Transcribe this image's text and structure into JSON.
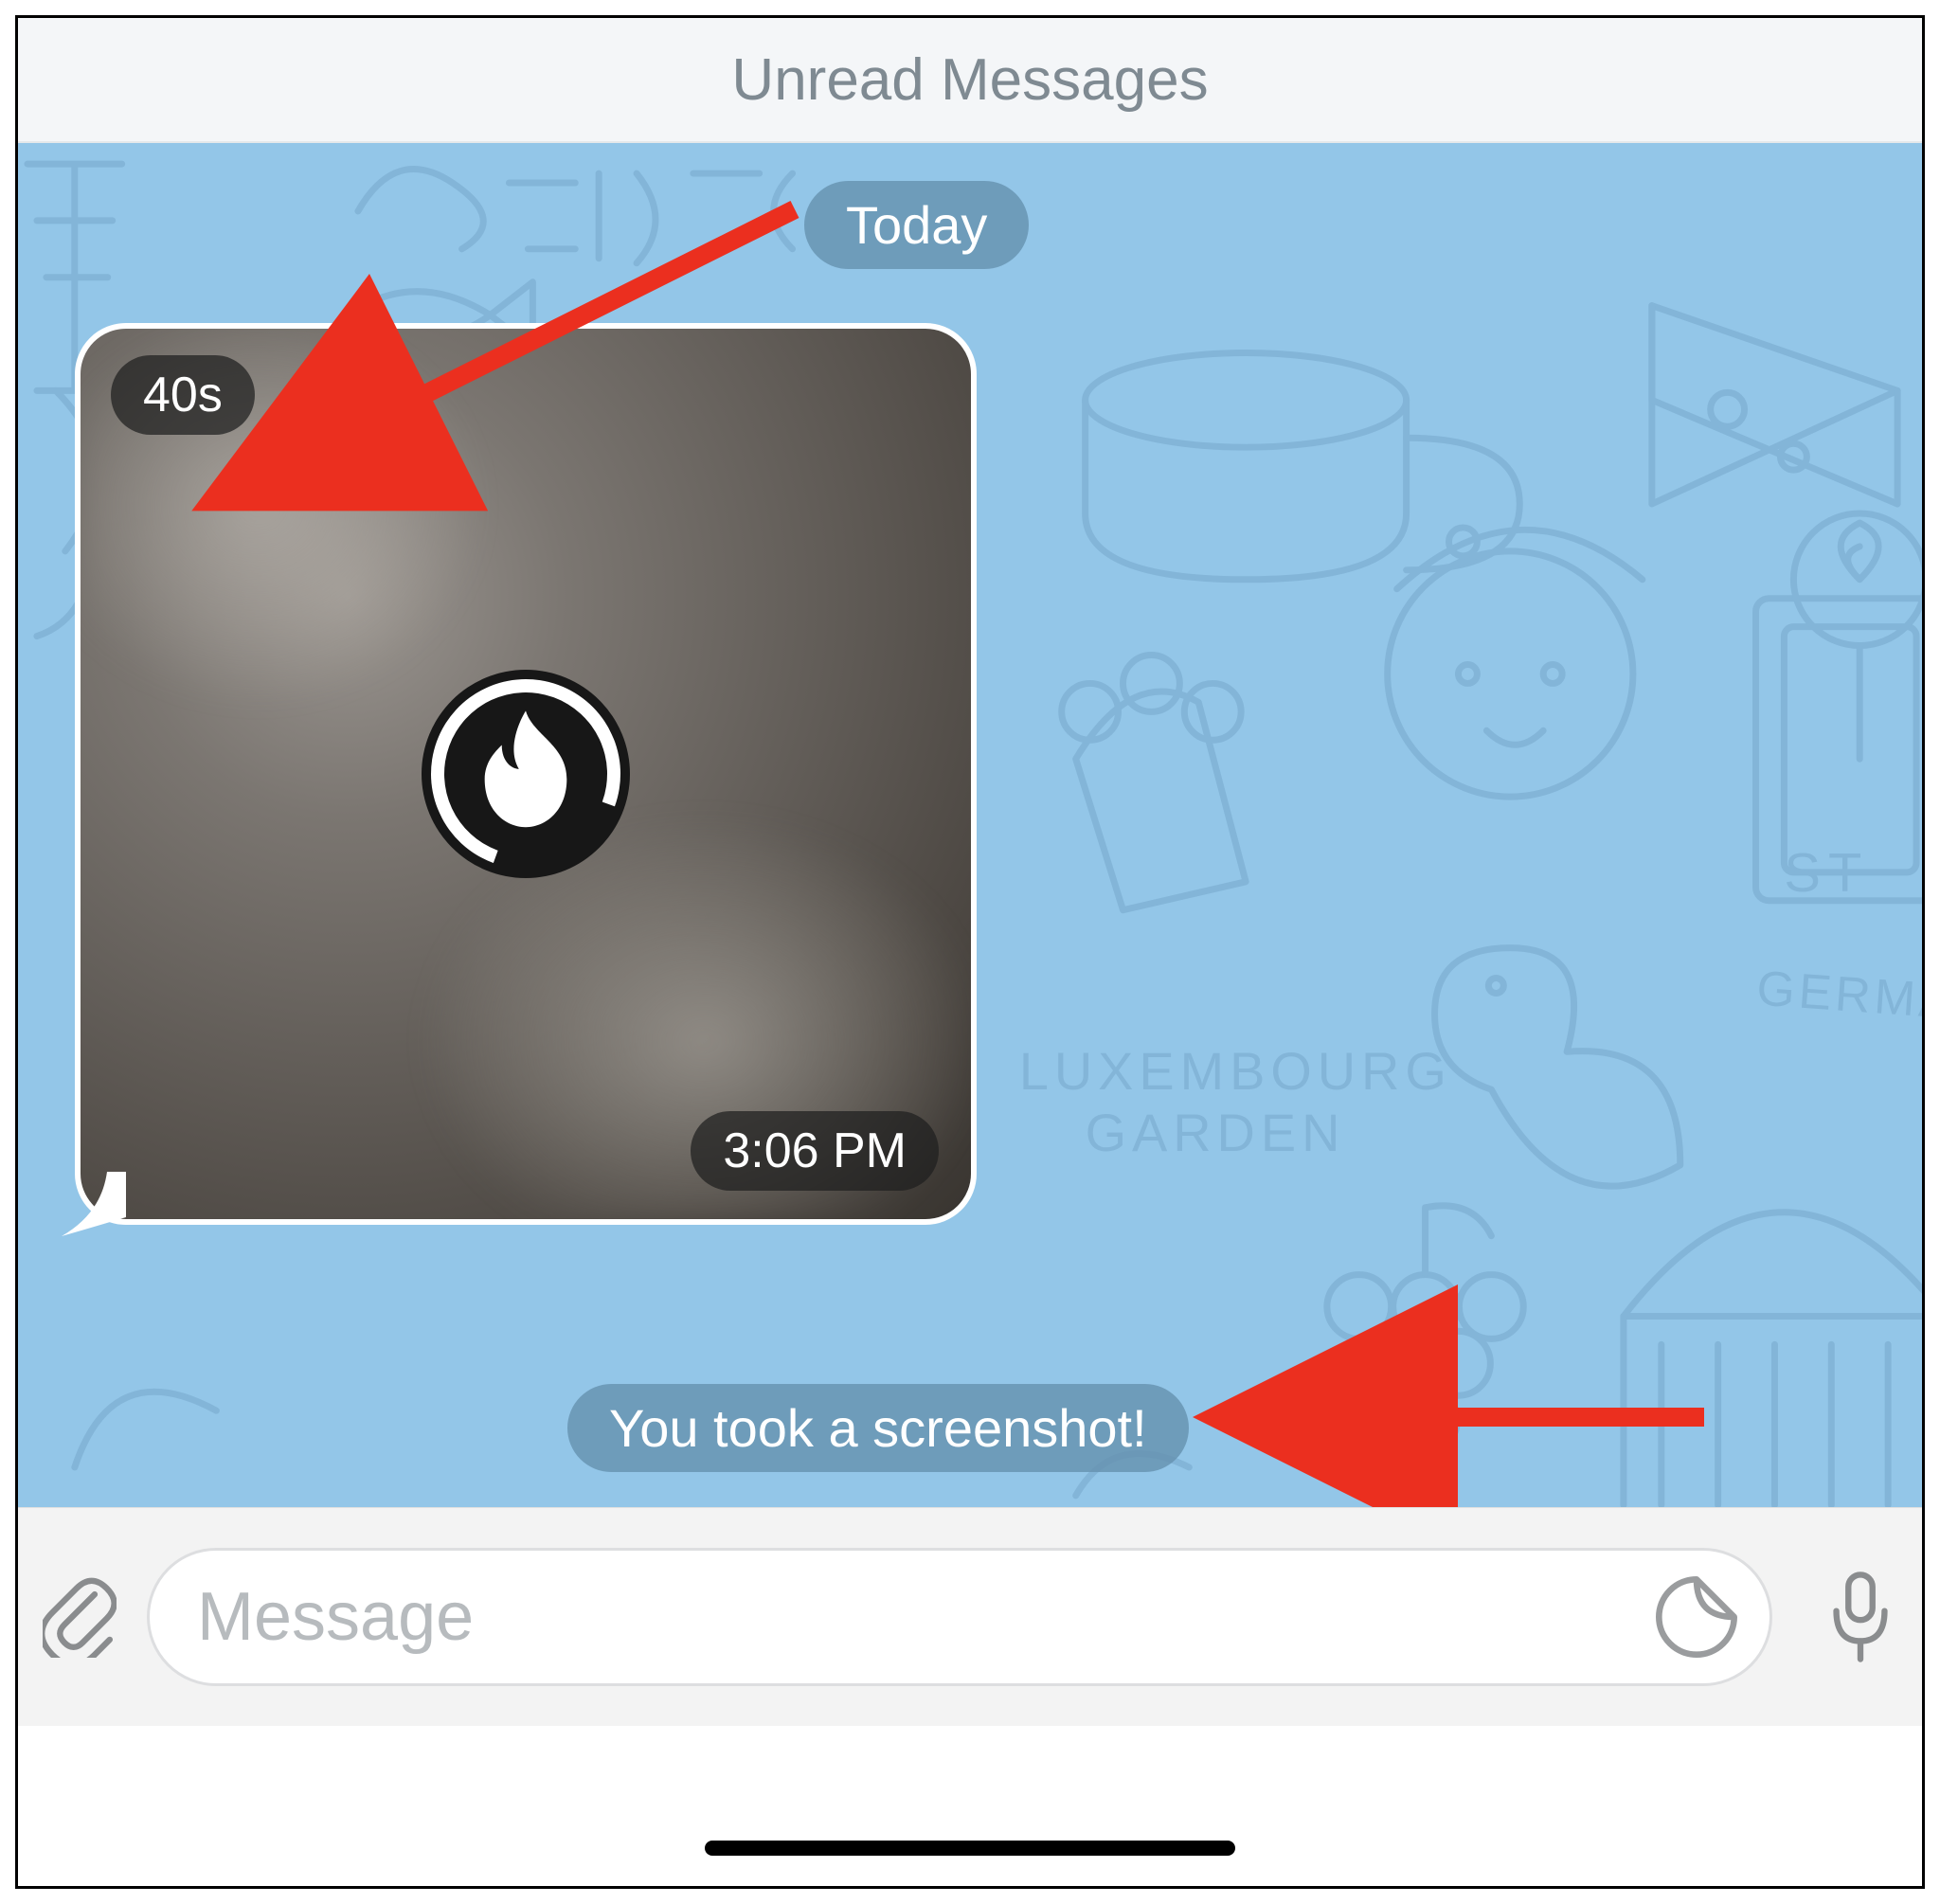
{
  "header": {
    "unread_label": "Unread Messages"
  },
  "chat": {
    "date_label": "Today",
    "screenshot_note": "You took a screenshot!",
    "bubble": {
      "countdown": "40s",
      "timestamp": "3:06 PM"
    }
  },
  "composer": {
    "placeholder": "Message"
  },
  "icons": {
    "flame": "flame-icon",
    "paperclip": "paperclip-icon",
    "sticker": "sticker-icon",
    "mic": "mic-icon"
  }
}
